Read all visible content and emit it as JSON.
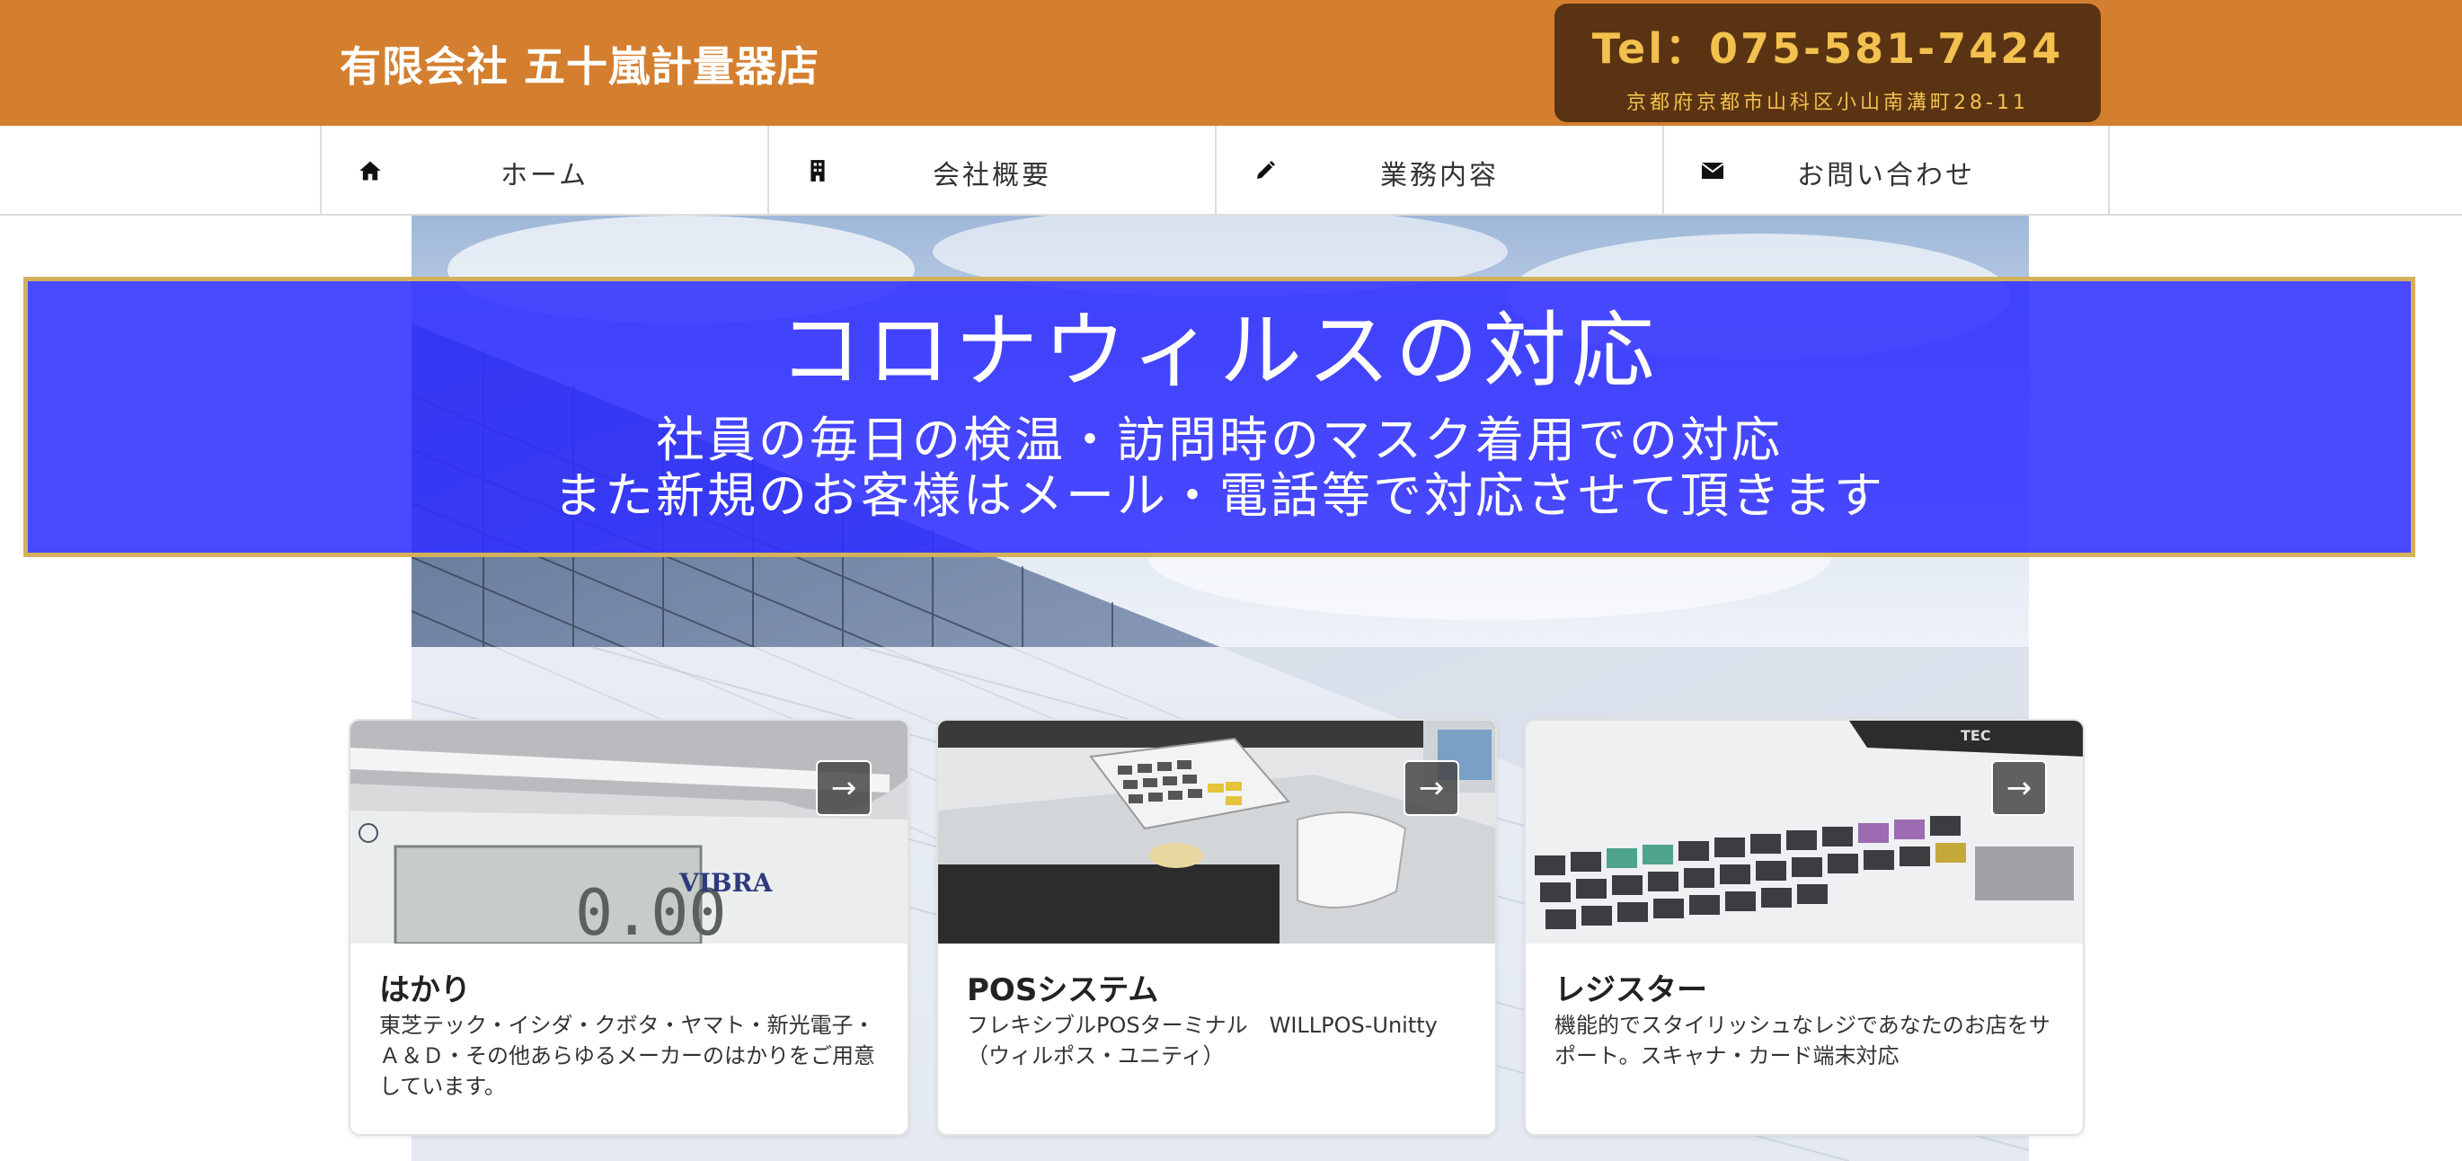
{
  "header": {
    "site_title": "有限会社 五十嵐計量器店",
    "tel": "Tel：075-581-7424",
    "address": "京都府京都市山科区小山南溝町28-11",
    "colors": {
      "bar": "#d47f2f",
      "contact_box": "#5a3412",
      "contact_text": "#f2c14e"
    }
  },
  "nav": {
    "items": [
      {
        "label": "ホーム",
        "icon": "home-icon"
      },
      {
        "label": "会社概要",
        "icon": "building-icon"
      },
      {
        "label": "業務内容",
        "icon": "pencil-icon"
      },
      {
        "label": "お問い合わせ",
        "icon": "envelope-icon"
      }
    ]
  },
  "notice": {
    "title": "コロナウィルスの対応",
    "line1": "社員の毎日の検温・訪問時のマスク着用での対応",
    "line2": "また新規のお客様はメール・電話等で対応させて頂きます",
    "colors": {
      "background": "#3030ff",
      "border": "#d4b05a"
    }
  },
  "cards": [
    {
      "title": "はかり",
      "desc": "東芝テック・イシダ・クボタ・ヤマト・新光電子・Ａ＆Ｄ・その他あらゆるメーカーのはかりをご用意しています。",
      "arrow": "→",
      "image_labels": {
        "brand": "VIBRA",
        "lcd": "0.00"
      }
    },
    {
      "title": "POSシステム",
      "desc": "フレキシブルPOSターミナル　WILLPOS-Unitty（ウィルポス・ユニティ）",
      "arrow": "→"
    },
    {
      "title": "レジスター",
      "desc": "機能的でスタイリッシュなレジであなたのお店をサポート。スキャナ・カード端末対応",
      "arrow": "→",
      "image_labels": {
        "brand": "TEC"
      }
    }
  ]
}
